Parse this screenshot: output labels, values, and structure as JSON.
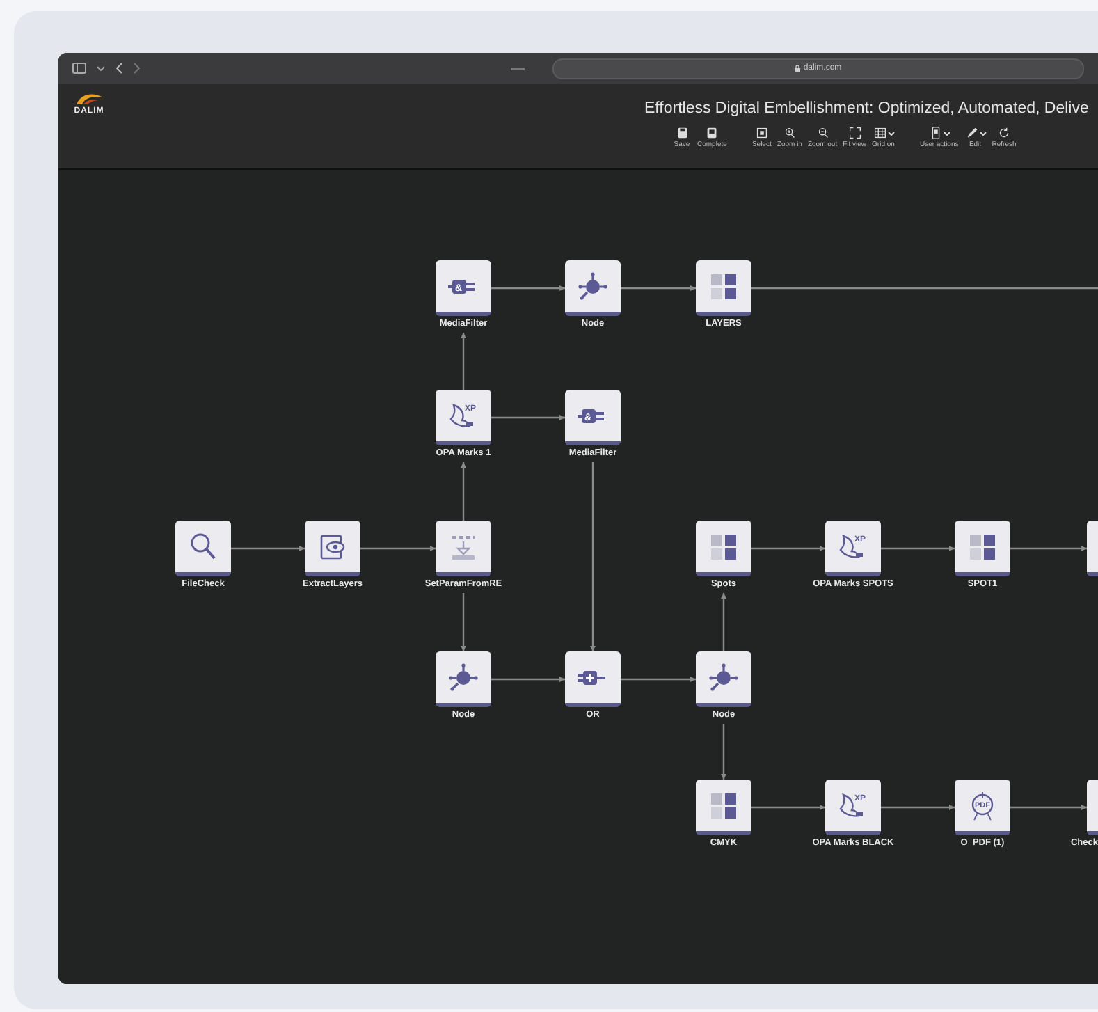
{
  "browser": {
    "address": "dalim.com"
  },
  "header": {
    "logo": "DALIM",
    "title": "Effortless Digital Embellishment: Optimized, Automated, Delive"
  },
  "toolbar_groups": [
    {
      "buttons": [
        {
          "label": "Save",
          "dropdown": false
        },
        {
          "label": "Complete",
          "dropdown": false
        }
      ]
    },
    {
      "buttons": [
        {
          "label": "Select",
          "dropdown": false
        },
        {
          "label": "Zoom in",
          "dropdown": false
        },
        {
          "label": "Zoom out",
          "dropdown": false
        },
        {
          "label": "Fit view",
          "dropdown": false
        },
        {
          "label": "Grid on",
          "dropdown": true
        }
      ]
    },
    {
      "buttons": [
        {
          "label": "User actions",
          "dropdown": true
        },
        {
          "label": "Edit",
          "dropdown": true
        },
        {
          "label": "Refresh",
          "dropdown": false
        }
      ]
    }
  ],
  "workflow": {
    "nodes": [
      {
        "kind": "filter",
        "icon_text": "&",
        "label": "MediaFilter"
      },
      {
        "kind": "hub",
        "label": "Node"
      },
      {
        "kind": "cmyk",
        "label": "LAYERS"
      },
      {
        "kind": "opa",
        "icon_text": "XP",
        "label": "OPA Marks 1"
      },
      {
        "kind": "filter",
        "icon_text": "&",
        "label": "MediaFilter"
      },
      {
        "kind": "search",
        "label": "FileCheck"
      },
      {
        "kind": "extract",
        "label": "ExtractLayers"
      },
      {
        "kind": "setparam",
        "label": "SetParamFromRE"
      },
      {
        "kind": "cmyk",
        "label": "Spots"
      },
      {
        "kind": "opa",
        "icon_text": "XP",
        "label": "OPA Marks SPOTS"
      },
      {
        "kind": "cmyk",
        "label": "SPOT1"
      },
      {
        "kind": "generic"
      },
      {
        "kind": "hub",
        "label": "Node"
      },
      {
        "kind": "or",
        "label": "OR"
      },
      {
        "kind": "hub",
        "label": "Node"
      },
      {
        "kind": "cmyk",
        "label": "CMYK"
      },
      {
        "kind": "opa",
        "icon_text": "XP",
        "label": "OPA Marks BLACK"
      },
      {
        "kind": "pdf",
        "icon_text": "PDF",
        "label": "O_PDF (1)"
      },
      {
        "kind": "generic",
        "label": "Check"
      }
    ]
  }
}
